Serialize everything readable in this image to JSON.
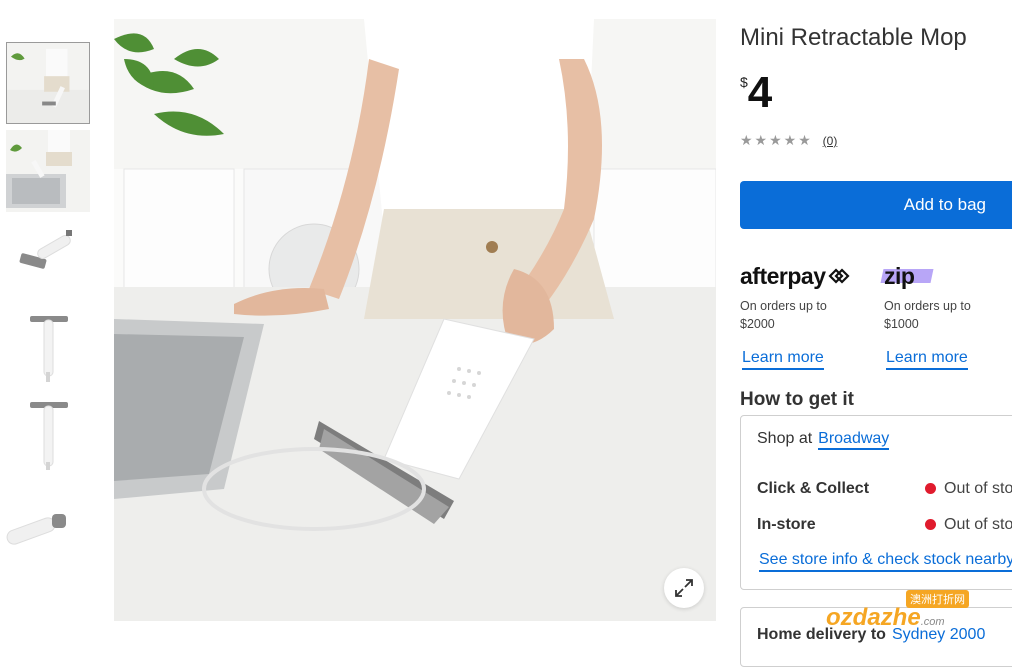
{
  "product": {
    "title": "Mini Retractable Mop",
    "currency": "$",
    "price": "4",
    "stars": "★★★★★",
    "review_count": "(0)",
    "add_to_bag": "Add to bag"
  },
  "payments": [
    {
      "logo": "afterpay",
      "text_line1": "On orders up to",
      "text_line2": "$2000",
      "link": "Learn more"
    },
    {
      "logo": "zip",
      "text_line1": "On orders up to",
      "text_line2": "$1000",
      "link": "Learn more"
    }
  ],
  "fulfilment": {
    "heading": "How to get it",
    "shop_at_label": "Shop at",
    "store_name": "Broadway",
    "options": [
      {
        "label": "Click & Collect",
        "status": "Out of stock"
      },
      {
        "label": "In-store",
        "status": "Out of stock"
      }
    ],
    "store_link": "See store info & check stock nearby",
    "delivery_label": "Home delivery to",
    "delivery_location": "Sydney 2000"
  },
  "watermark": {
    "text": "ozdazhe",
    "suffix": ".com",
    "badge": "澳洲打折网"
  },
  "colors": {
    "accent": "#0a6dd8",
    "out_of_stock": "#e01b2d"
  },
  "icons": {
    "expand": "expand-icon",
    "stars": "star-icon"
  }
}
